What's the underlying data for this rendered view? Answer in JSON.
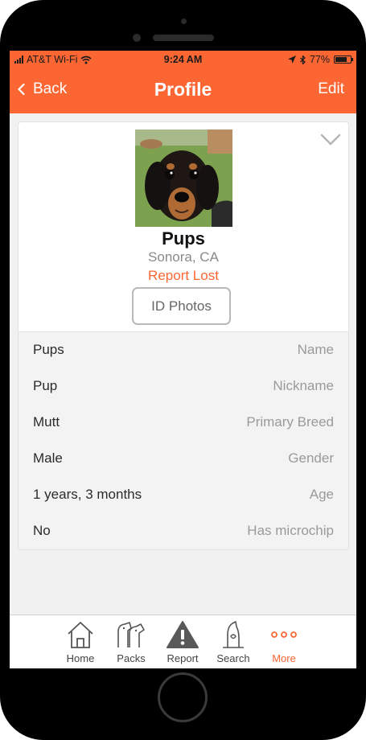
{
  "status_bar": {
    "carrier": "AT&T Wi-Fi",
    "time": "9:24 AM",
    "battery": "77%",
    "battery_level": 0.77
  },
  "nav": {
    "back_label": "Back",
    "title": "Profile",
    "edit_label": "Edit"
  },
  "pet": {
    "name": "Pups",
    "location": "Sonora, CA",
    "report_lost": "Report Lost",
    "id_photos": "ID Photos"
  },
  "details": [
    {
      "value": "Pups",
      "label": "Name"
    },
    {
      "value": "Pup",
      "label": "Nickname"
    },
    {
      "value": "Mutt",
      "label": "Primary Breed"
    },
    {
      "value": "Male",
      "label": "Gender"
    },
    {
      "value": "1 years, 3 months",
      "label": "Age"
    },
    {
      "value": "No",
      "label": "Has microchip"
    }
  ],
  "tabs": [
    {
      "label": "Home",
      "icon": "house-icon"
    },
    {
      "label": "Packs",
      "icon": "dogs-icon"
    },
    {
      "label": "Report",
      "icon": "warning-icon"
    },
    {
      "label": "Search",
      "icon": "search-dog-icon"
    },
    {
      "label": "More",
      "icon": "more-icon",
      "active": true
    }
  ],
  "colors": {
    "accent": "#fc6633",
    "background": "#f1f1f1",
    "muted_text": "#9a9a9a"
  }
}
